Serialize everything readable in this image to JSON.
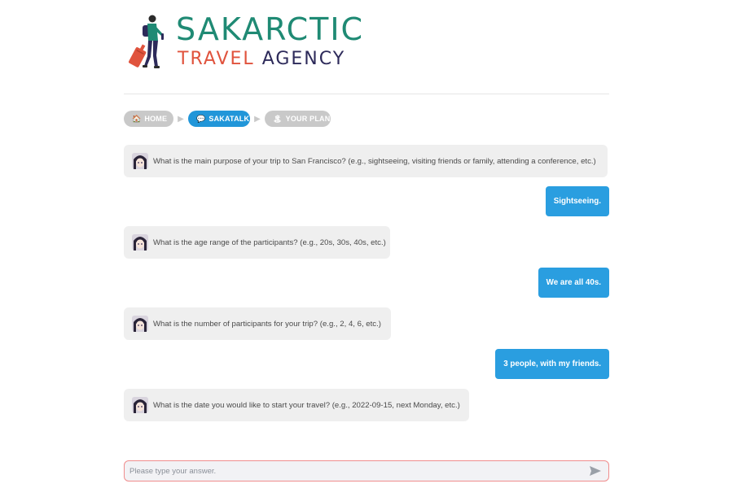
{
  "logo": {
    "line1": "SAKARCTIC",
    "line2_part1": "TRAVEL",
    "line2_part2": "AGENCY",
    "figure_icon": "traveler-with-suitcase-icon"
  },
  "breadcrumb": {
    "items": [
      {
        "label": "HOME",
        "icon": "house-icon",
        "glyph": "🏠"
      },
      {
        "label": "SAKATALK",
        "icon": "speech-bubble-icon",
        "glyph": "💬"
      },
      {
        "label": "YOUR PLAN",
        "icon": "beach-icon",
        "glyph": "🏝"
      }
    ],
    "separator": "▶"
  },
  "conversation": [
    {
      "role": "bot",
      "text": "What is the main purpose of your trip to San Francisco? (e.g., sightseeing, visiting friends or family, attending a conference, etc.)"
    },
    {
      "role": "user",
      "text": "Sightseeing."
    },
    {
      "role": "bot",
      "text": "What is the age range of the participants? (e.g., 20s, 30s, 40s, etc.)"
    },
    {
      "role": "user",
      "text": "We are all 40s."
    },
    {
      "role": "bot",
      "text": "What is the number of participants for your trip? (e.g., 2, 4, 6, etc.)"
    },
    {
      "role": "user",
      "text": "3 people, with my friends."
    },
    {
      "role": "bot",
      "text": "What is the date you would like to start your travel? (e.g., 2022-09-15, next Monday, etc.)"
    }
  ],
  "input": {
    "placeholder": "Please type your answer.",
    "value": "",
    "send_icon": "send-arrow-icon"
  },
  "colors": {
    "accent": "#2196d9",
    "user_bubble": "#2a9ee0",
    "bot_bubble": "#efefef",
    "logo_green": "#1f8a74",
    "logo_red": "#e0533d",
    "logo_navy": "#2d2a5a",
    "input_border": "#f08d8d"
  }
}
